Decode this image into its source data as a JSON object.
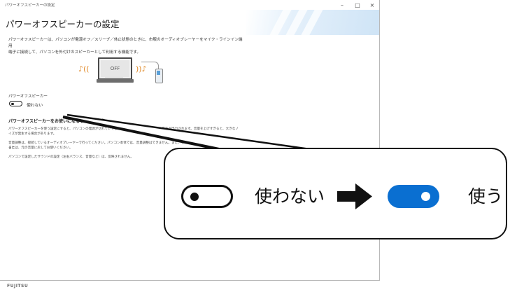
{
  "window": {
    "title": "パワーオフスピーカーの設定",
    "minimize_glyph": "–",
    "maximize_glyph": "□",
    "close_glyph": "×"
  },
  "page": {
    "heading": "パワーオフスピーカーの設定",
    "description_line1": "パワーオフスピーカーは、パソコンが電源オフ／スリープ／休止状態のときに、市販のオーディオプレーヤーをマイク・ラインイン端用",
    "description_line2": "端子に接続して、パソコンを外付けのスピーカーとして利用する機能です。"
  },
  "illustration": {
    "screen_text": "OFF",
    "icons": [
      "monitor-icon",
      "speaker-wave-icon",
      "audio-player-icon"
    ]
  },
  "speaker_setting": {
    "label": "パワーオフスピーカー",
    "toggle_state": "off",
    "toggle_label": "使わない"
  },
  "caution": {
    "heading": "パワーオフスピーカーをお使いになるうえでの注意",
    "note1": "パワーオフスピーカーを使う設定にすると、パソコンの電源が切れていても、オーディオプレーヤーからの音声が出力されます。音量を上げすぎると、大きなノイズが発生する場合があります。",
    "note2": "音量調整は、接続しているオーディオプレーヤーで行ってください。パソコン本体では、音量調整はできません。また、そのままオーディオプレーヤーを操作すると、",
    "note3": "または、元の音量に戻してお使いください。",
    "note4": "パソコンで設定したサウンドの設定（左右バランス、音量など）は、反映されません。"
  },
  "callout": {
    "off_label": "使わない",
    "on_label": "使う",
    "accent_color": "#0a6fd1"
  },
  "footer": {
    "brand": "FUJITSU"
  }
}
